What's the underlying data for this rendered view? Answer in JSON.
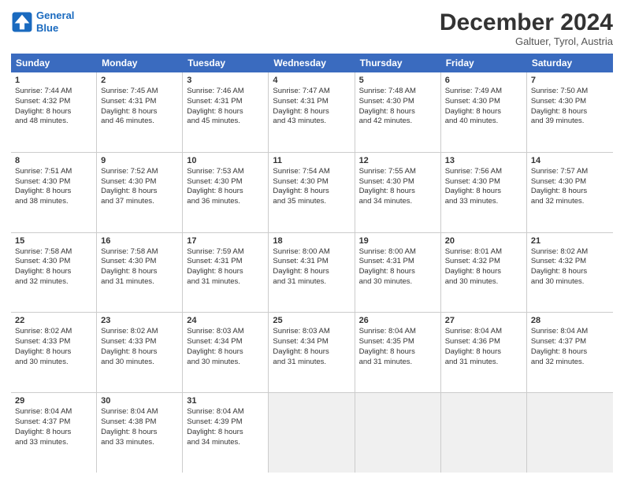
{
  "header": {
    "logo_line1": "General",
    "logo_line2": "Blue",
    "month": "December 2024",
    "location": "Galtuer, Tyrol, Austria"
  },
  "days_of_week": [
    "Sunday",
    "Monday",
    "Tuesday",
    "Wednesday",
    "Thursday",
    "Friday",
    "Saturday"
  ],
  "weeks": [
    [
      {
        "day": "1",
        "lines": [
          "Sunrise: 7:44 AM",
          "Sunset: 4:32 PM",
          "Daylight: 8 hours",
          "and 48 minutes."
        ]
      },
      {
        "day": "2",
        "lines": [
          "Sunrise: 7:45 AM",
          "Sunset: 4:31 PM",
          "Daylight: 8 hours",
          "and 46 minutes."
        ]
      },
      {
        "day": "3",
        "lines": [
          "Sunrise: 7:46 AM",
          "Sunset: 4:31 PM",
          "Daylight: 8 hours",
          "and 45 minutes."
        ]
      },
      {
        "day": "4",
        "lines": [
          "Sunrise: 7:47 AM",
          "Sunset: 4:31 PM",
          "Daylight: 8 hours",
          "and 43 minutes."
        ]
      },
      {
        "day": "5",
        "lines": [
          "Sunrise: 7:48 AM",
          "Sunset: 4:30 PM",
          "Daylight: 8 hours",
          "and 42 minutes."
        ]
      },
      {
        "day": "6",
        "lines": [
          "Sunrise: 7:49 AM",
          "Sunset: 4:30 PM",
          "Daylight: 8 hours",
          "and 40 minutes."
        ]
      },
      {
        "day": "7",
        "lines": [
          "Sunrise: 7:50 AM",
          "Sunset: 4:30 PM",
          "Daylight: 8 hours",
          "and 39 minutes."
        ]
      }
    ],
    [
      {
        "day": "8",
        "lines": [
          "Sunrise: 7:51 AM",
          "Sunset: 4:30 PM",
          "Daylight: 8 hours",
          "and 38 minutes."
        ]
      },
      {
        "day": "9",
        "lines": [
          "Sunrise: 7:52 AM",
          "Sunset: 4:30 PM",
          "Daylight: 8 hours",
          "and 37 minutes."
        ]
      },
      {
        "day": "10",
        "lines": [
          "Sunrise: 7:53 AM",
          "Sunset: 4:30 PM",
          "Daylight: 8 hours",
          "and 36 minutes."
        ]
      },
      {
        "day": "11",
        "lines": [
          "Sunrise: 7:54 AM",
          "Sunset: 4:30 PM",
          "Daylight: 8 hours",
          "and 35 minutes."
        ]
      },
      {
        "day": "12",
        "lines": [
          "Sunrise: 7:55 AM",
          "Sunset: 4:30 PM",
          "Daylight: 8 hours",
          "and 34 minutes."
        ]
      },
      {
        "day": "13",
        "lines": [
          "Sunrise: 7:56 AM",
          "Sunset: 4:30 PM",
          "Daylight: 8 hours",
          "and 33 minutes."
        ]
      },
      {
        "day": "14",
        "lines": [
          "Sunrise: 7:57 AM",
          "Sunset: 4:30 PM",
          "Daylight: 8 hours",
          "and 32 minutes."
        ]
      }
    ],
    [
      {
        "day": "15",
        "lines": [
          "Sunrise: 7:58 AM",
          "Sunset: 4:30 PM",
          "Daylight: 8 hours",
          "and 32 minutes."
        ]
      },
      {
        "day": "16",
        "lines": [
          "Sunrise: 7:58 AM",
          "Sunset: 4:30 PM",
          "Daylight: 8 hours",
          "and 31 minutes."
        ]
      },
      {
        "day": "17",
        "lines": [
          "Sunrise: 7:59 AM",
          "Sunset: 4:31 PM",
          "Daylight: 8 hours",
          "and 31 minutes."
        ]
      },
      {
        "day": "18",
        "lines": [
          "Sunrise: 8:00 AM",
          "Sunset: 4:31 PM",
          "Daylight: 8 hours",
          "and 31 minutes."
        ]
      },
      {
        "day": "19",
        "lines": [
          "Sunrise: 8:00 AM",
          "Sunset: 4:31 PM",
          "Daylight: 8 hours",
          "and 30 minutes."
        ]
      },
      {
        "day": "20",
        "lines": [
          "Sunrise: 8:01 AM",
          "Sunset: 4:32 PM",
          "Daylight: 8 hours",
          "and 30 minutes."
        ]
      },
      {
        "day": "21",
        "lines": [
          "Sunrise: 8:02 AM",
          "Sunset: 4:32 PM",
          "Daylight: 8 hours",
          "and 30 minutes."
        ]
      }
    ],
    [
      {
        "day": "22",
        "lines": [
          "Sunrise: 8:02 AM",
          "Sunset: 4:33 PM",
          "Daylight: 8 hours",
          "and 30 minutes."
        ]
      },
      {
        "day": "23",
        "lines": [
          "Sunrise: 8:02 AM",
          "Sunset: 4:33 PM",
          "Daylight: 8 hours",
          "and 30 minutes."
        ]
      },
      {
        "day": "24",
        "lines": [
          "Sunrise: 8:03 AM",
          "Sunset: 4:34 PM",
          "Daylight: 8 hours",
          "and 30 minutes."
        ]
      },
      {
        "day": "25",
        "lines": [
          "Sunrise: 8:03 AM",
          "Sunset: 4:34 PM",
          "Daylight: 8 hours",
          "and 31 minutes."
        ]
      },
      {
        "day": "26",
        "lines": [
          "Sunrise: 8:04 AM",
          "Sunset: 4:35 PM",
          "Daylight: 8 hours",
          "and 31 minutes."
        ]
      },
      {
        "day": "27",
        "lines": [
          "Sunrise: 8:04 AM",
          "Sunset: 4:36 PM",
          "Daylight: 8 hours",
          "and 31 minutes."
        ]
      },
      {
        "day": "28",
        "lines": [
          "Sunrise: 8:04 AM",
          "Sunset: 4:37 PM",
          "Daylight: 8 hours",
          "and 32 minutes."
        ]
      }
    ],
    [
      {
        "day": "29",
        "lines": [
          "Sunrise: 8:04 AM",
          "Sunset: 4:37 PM",
          "Daylight: 8 hours",
          "and 33 minutes."
        ]
      },
      {
        "day": "30",
        "lines": [
          "Sunrise: 8:04 AM",
          "Sunset: 4:38 PM",
          "Daylight: 8 hours",
          "and 33 minutes."
        ]
      },
      {
        "day": "31",
        "lines": [
          "Sunrise: 8:04 AM",
          "Sunset: 4:39 PM",
          "Daylight: 8 hours",
          "and 34 minutes."
        ]
      },
      {
        "day": "",
        "lines": []
      },
      {
        "day": "",
        "lines": []
      },
      {
        "day": "",
        "lines": []
      },
      {
        "day": "",
        "lines": []
      }
    ]
  ]
}
